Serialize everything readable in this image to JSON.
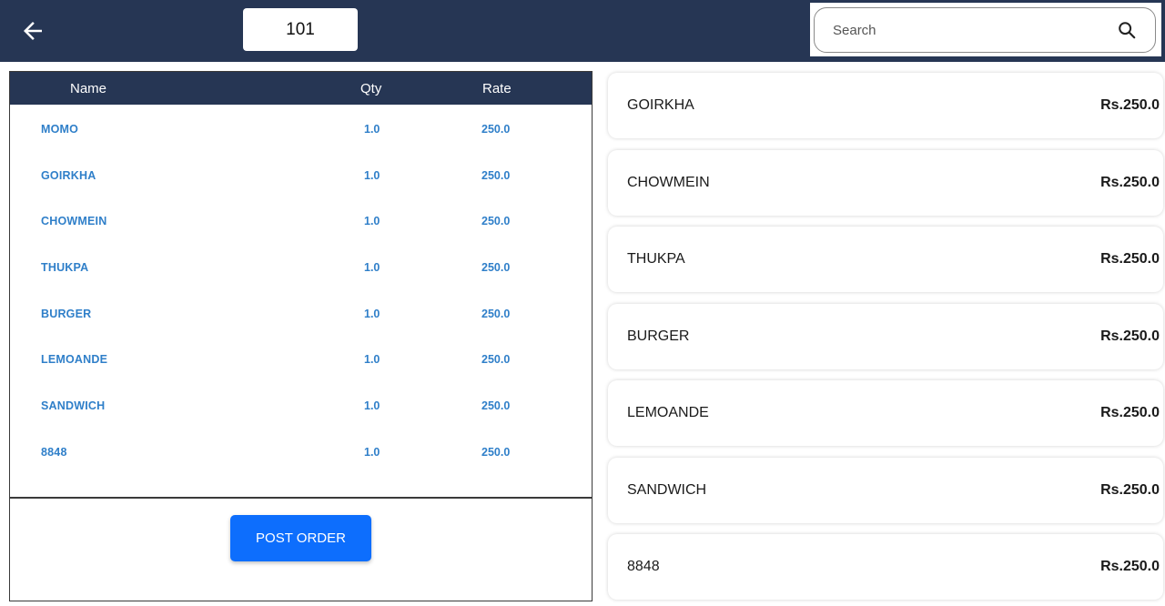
{
  "header": {
    "table_number": "101",
    "search_placeholder": "Search"
  },
  "order": {
    "columns": {
      "name": "Name",
      "qty": "Qty",
      "rate": "Rate"
    },
    "rows": [
      {
        "name": "MOMO",
        "qty": "1.0",
        "rate": "250.0"
      },
      {
        "name": "GOIRKHA",
        "qty": "1.0",
        "rate": "250.0"
      },
      {
        "name": "CHOWMEIN",
        "qty": "1.0",
        "rate": "250.0"
      },
      {
        "name": "THUKPA",
        "qty": "1.0",
        "rate": "250.0"
      },
      {
        "name": "BURGER",
        "qty": "1.0",
        "rate": "250.0"
      },
      {
        "name": "LEMOANDE",
        "qty": "1.0",
        "rate": "250.0"
      },
      {
        "name": "SANDWICH",
        "qty": "1.0",
        "rate": "250.0"
      },
      {
        "name": "8848",
        "qty": "1.0",
        "rate": "250.0"
      }
    ],
    "post_button_label": "POST ORDER"
  },
  "menu": {
    "items": [
      {
        "name": "GOIRKHA",
        "price": "Rs.250.0"
      },
      {
        "name": "CHOWMEIN",
        "price": "Rs.250.0"
      },
      {
        "name": "THUKPA",
        "price": "Rs.250.0"
      },
      {
        "name": "BURGER",
        "price": "Rs.250.0"
      },
      {
        "name": "LEMOANDE",
        "price": "Rs.250.0"
      },
      {
        "name": "SANDWICH",
        "price": "Rs.250.0"
      },
      {
        "name": "8848",
        "price": "Rs.250.0"
      }
    ]
  },
  "icons": {
    "back": "back-arrow-icon",
    "search": "search-icon"
  },
  "colors": {
    "header_bg": "#263654",
    "row_text": "#2f7fc9",
    "post_button": "#0d6efd"
  }
}
